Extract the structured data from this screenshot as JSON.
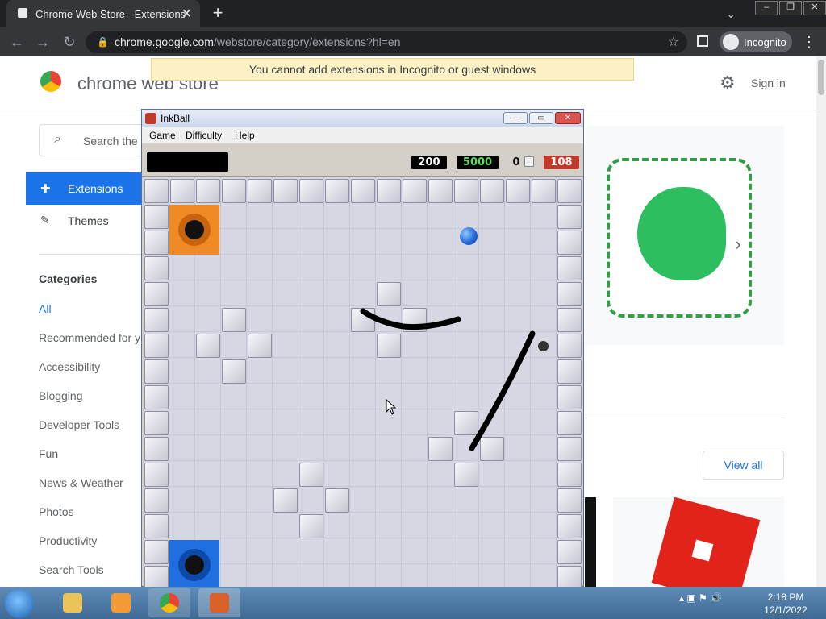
{
  "browser": {
    "tab_title": "Chrome Web Store - Extensions",
    "url_host": "chrome.google.com",
    "url_path": "/webstore/category/extensions?hl=en",
    "incognito_label": "Incognito"
  },
  "store": {
    "brand": "chrome web store",
    "banner": "You cannot add extensions in Incognito or guest windows",
    "sign_in": "Sign in",
    "search_placeholder": "Search the",
    "nav": {
      "extensions": "Extensions",
      "themes": "Themes"
    },
    "categories_heading": "Categories",
    "categories": [
      "All",
      "Recommended for y",
      "Accessibility",
      "Blogging",
      "Developer Tools",
      "Fun",
      "News & Weather",
      "Photos",
      "Productivity",
      "Search Tools"
    ],
    "view_all": "View all"
  },
  "inkball": {
    "title": "InkBall",
    "menu": [
      "Game",
      "Difficulty",
      "Help"
    ],
    "score": "200",
    "high_score": "5000",
    "balls_count": "0",
    "time": "108",
    "colors": {
      "score_text": "#ffffff",
      "high_text": "#5fdc5f",
      "time_bg": "#c0392b",
      "orange_hole": "#f08a24",
      "blue_hole": "#1f6fe0",
      "ball": "#1f63d6"
    }
  },
  "taskbar": {
    "time": "2:18 PM",
    "date": "12/1/2022"
  }
}
